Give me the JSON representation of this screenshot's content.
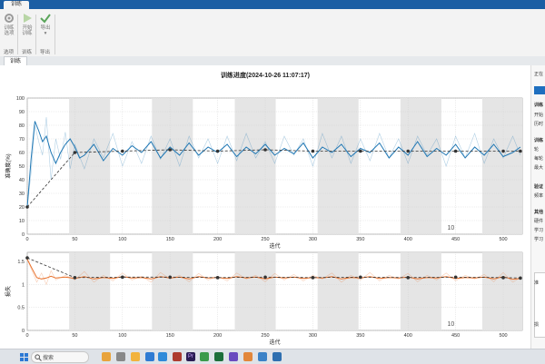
{
  "window": {
    "tab_title": "训练"
  },
  "ribbon": {
    "buttons": [
      {
        "label1": "训练",
        "label2": "选项",
        "icon": "gear-icon"
      },
      {
        "label1": "开始",
        "label2": "训练",
        "icon": "play-icon"
      },
      {
        "label1": "导出",
        "label2": "▾",
        "icon": "check-export-icon"
      }
    ],
    "group_labels": [
      "选项",
      "训练",
      "导出"
    ]
  },
  "doc_tab": "训练",
  "plot": {
    "title": "训练进度(2024-10-26 11:07:17)"
  },
  "right_panel": {
    "items": [
      "正在",
      "训练",
      "开始",
      "历时",
      "训练",
      "轮",
      "每轮",
      "最大",
      "验证",
      "频率",
      "其他",
      "硬件",
      "学习",
      "学习",
      "准",
      "损"
    ]
  },
  "taskbar": {
    "search_label": "搜索"
  },
  "colors": {
    "accent": "#1b5ea4",
    "accuracy": "#1f77b4",
    "loss": "#e8702a",
    "shade": "#e5e5e5"
  },
  "chart_data": [
    {
      "type": "line",
      "ylabel": "准确度(%)",
      "xlabel": "迭代",
      "xlim": [
        0,
        520
      ],
      "ylim": [
        0,
        100
      ],
      "x_ticks": [
        0,
        50,
        100,
        150,
        200,
        250,
        300,
        350,
        400,
        450,
        500
      ],
      "y_ticks": [
        0,
        10,
        20,
        30,
        40,
        50,
        60,
        70,
        80,
        90,
        100
      ],
      "epoch_shading": [
        [
          44,
          87
        ],
        [
          131,
          174
        ],
        [
          218,
          261
        ],
        [
          305,
          348
        ],
        [
          392,
          435
        ],
        [
          478,
          520
        ]
      ],
      "annotation": "10",
      "grid": true,
      "series": [
        {
          "style": "raw",
          "x": [
            0,
            4,
            8,
            12,
            16,
            20,
            25,
            30,
            35,
            40,
            45,
            50,
            60,
            70,
            80,
            90,
            100,
            110,
            120,
            130,
            140,
            150,
            160,
            170,
            180,
            190,
            200,
            210,
            220,
            230,
            240,
            250,
            260,
            270,
            280,
            290,
            300,
            310,
            320,
            330,
            340,
            350,
            360,
            370,
            380,
            390,
            400,
            410,
            420,
            430,
            440,
            450,
            460,
            470,
            480,
            490,
            500,
            510,
            518
          ],
          "y": [
            20,
            45,
            80,
            68,
            58,
            86,
            40,
            70,
            55,
            75,
            48,
            66,
            48,
            70,
            56,
            74,
            50,
            68,
            52,
            72,
            55,
            70,
            50,
            72,
            56,
            70,
            52,
            72,
            54,
            74,
            56,
            68,
            52,
            72,
            58,
            70,
            50,
            74,
            56,
            72,
            52,
            70,
            54,
            74,
            56,
            70,
            52,
            72,
            58,
            70,
            50,
            72,
            56,
            74,
            52,
            70,
            56,
            72,
            58
          ]
        },
        {
          "style": "smoothed",
          "x": [
            0,
            4,
            8,
            12,
            16,
            20,
            25,
            30,
            35,
            40,
            45,
            50,
            55,
            60,
            70,
            80,
            90,
            100,
            110,
            120,
            130,
            140,
            150,
            160,
            170,
            180,
            190,
            200,
            210,
            220,
            230,
            240,
            250,
            260,
            270,
            280,
            290,
            300,
            310,
            320,
            330,
            340,
            350,
            360,
            370,
            380,
            390,
            400,
            410,
            420,
            430,
            440,
            450,
            460,
            470,
            480,
            490,
            500,
            510,
            518
          ],
          "y": [
            20,
            55,
            83,
            76,
            68,
            72,
            60,
            52,
            60,
            66,
            70,
            64,
            56,
            58,
            66,
            54,
            63,
            58,
            65,
            60,
            68,
            56,
            64,
            58,
            67,
            58,
            64,
            60,
            66,
            57,
            64,
            59,
            66,
            58,
            63,
            59,
            67,
            56,
            64,
            60,
            66,
            57,
            63,
            60,
            67,
            56,
            64,
            58,
            68,
            57,
            63,
            58,
            66,
            56,
            64,
            58,
            66,
            57,
            60,
            64
          ]
        },
        {
          "style": "validation",
          "x": [
            0,
            50,
            100,
            150,
            200,
            250,
            300,
            350,
            400,
            450,
            500,
            518
          ],
          "y": [
            20,
            60,
            61,
            62,
            61,
            62,
            61,
            61,
            61,
            61,
            61,
            61
          ]
        }
      ]
    },
    {
      "type": "line",
      "ylabel": "损失",
      "xlabel": "迭代",
      "xlim": [
        0,
        520
      ],
      "ylim": [
        0,
        1.7
      ],
      "x_ticks": [
        0,
        50,
        100,
        150,
        200,
        250,
        300,
        350,
        400,
        450,
        500
      ],
      "y_ticks": [
        0,
        0.5,
        1,
        1.5
      ],
      "epoch_shading": [
        [
          44,
          87
        ],
        [
          131,
          174
        ],
        [
          218,
          261
        ],
        [
          305,
          348
        ],
        [
          392,
          435
        ],
        [
          478,
          520
        ]
      ],
      "annotation": "10",
      "grid": true,
      "series": [
        {
          "style": "raw",
          "x": [
            0,
            5,
            10,
            15,
            20,
            25,
            30,
            40,
            50,
            60,
            70,
            80,
            90,
            100,
            110,
            120,
            130,
            140,
            150,
            160,
            170,
            180,
            190,
            200,
            210,
            220,
            230,
            240,
            250,
            260,
            270,
            280,
            290,
            300,
            310,
            320,
            330,
            340,
            350,
            360,
            370,
            380,
            390,
            400,
            410,
            420,
            430,
            440,
            450,
            460,
            470,
            480,
            490,
            500,
            510,
            518
          ],
          "y": [
            1.55,
            1.3,
            1.05,
            1.25,
            1.0,
            1.3,
            1.1,
            1.2,
            1.1,
            1.28,
            1.05,
            1.2,
            1.08,
            1.25,
            1.1,
            1.18,
            1.05,
            1.26,
            1.12,
            1.2,
            1.06,
            1.24,
            1.1,
            1.18,
            1.08,
            1.25,
            1.12,
            1.2,
            1.06,
            1.24,
            1.1,
            1.22,
            1.08,
            1.2,
            1.12,
            1.25,
            1.05,
            1.2,
            1.1,
            1.26,
            1.08,
            1.2,
            1.12,
            1.24,
            1.06,
            1.2,
            1.1,
            1.25,
            1.08,
            1.2,
            1.12,
            1.22,
            1.06,
            1.26,
            1.05,
            1.15
          ]
        },
        {
          "style": "smoothed",
          "x": [
            0,
            5,
            10,
            15,
            20,
            25,
            30,
            40,
            50,
            60,
            70,
            80,
            90,
            100,
            110,
            120,
            130,
            140,
            150,
            160,
            170,
            180,
            190,
            200,
            210,
            220,
            230,
            240,
            250,
            260,
            270,
            280,
            290,
            300,
            310,
            320,
            330,
            340,
            350,
            360,
            370,
            380,
            390,
            400,
            410,
            420,
            430,
            440,
            450,
            460,
            470,
            480,
            490,
            500,
            510,
            518
          ],
          "y": [
            1.55,
            1.35,
            1.15,
            1.12,
            1.14,
            1.18,
            1.14,
            1.16,
            1.13,
            1.17,
            1.12,
            1.15,
            1.13,
            1.17,
            1.14,
            1.15,
            1.12,
            1.17,
            1.14,
            1.16,
            1.12,
            1.17,
            1.14,
            1.15,
            1.13,
            1.17,
            1.14,
            1.16,
            1.12,
            1.16,
            1.14,
            1.16,
            1.13,
            1.15,
            1.14,
            1.17,
            1.12,
            1.15,
            1.14,
            1.17,
            1.13,
            1.15,
            1.14,
            1.16,
            1.12,
            1.15,
            1.14,
            1.17,
            1.13,
            1.15,
            1.14,
            1.16,
            1.12,
            1.17,
            1.11,
            1.13
          ]
        },
        {
          "style": "validation",
          "x": [
            0,
            50,
            100,
            150,
            200,
            250,
            300,
            350,
            400,
            450,
            500,
            518
          ],
          "y": [
            1.58,
            1.15,
            1.16,
            1.16,
            1.15,
            1.16,
            1.15,
            1.16,
            1.15,
            1.16,
            1.15,
            1.14
          ]
        }
      ]
    }
  ]
}
